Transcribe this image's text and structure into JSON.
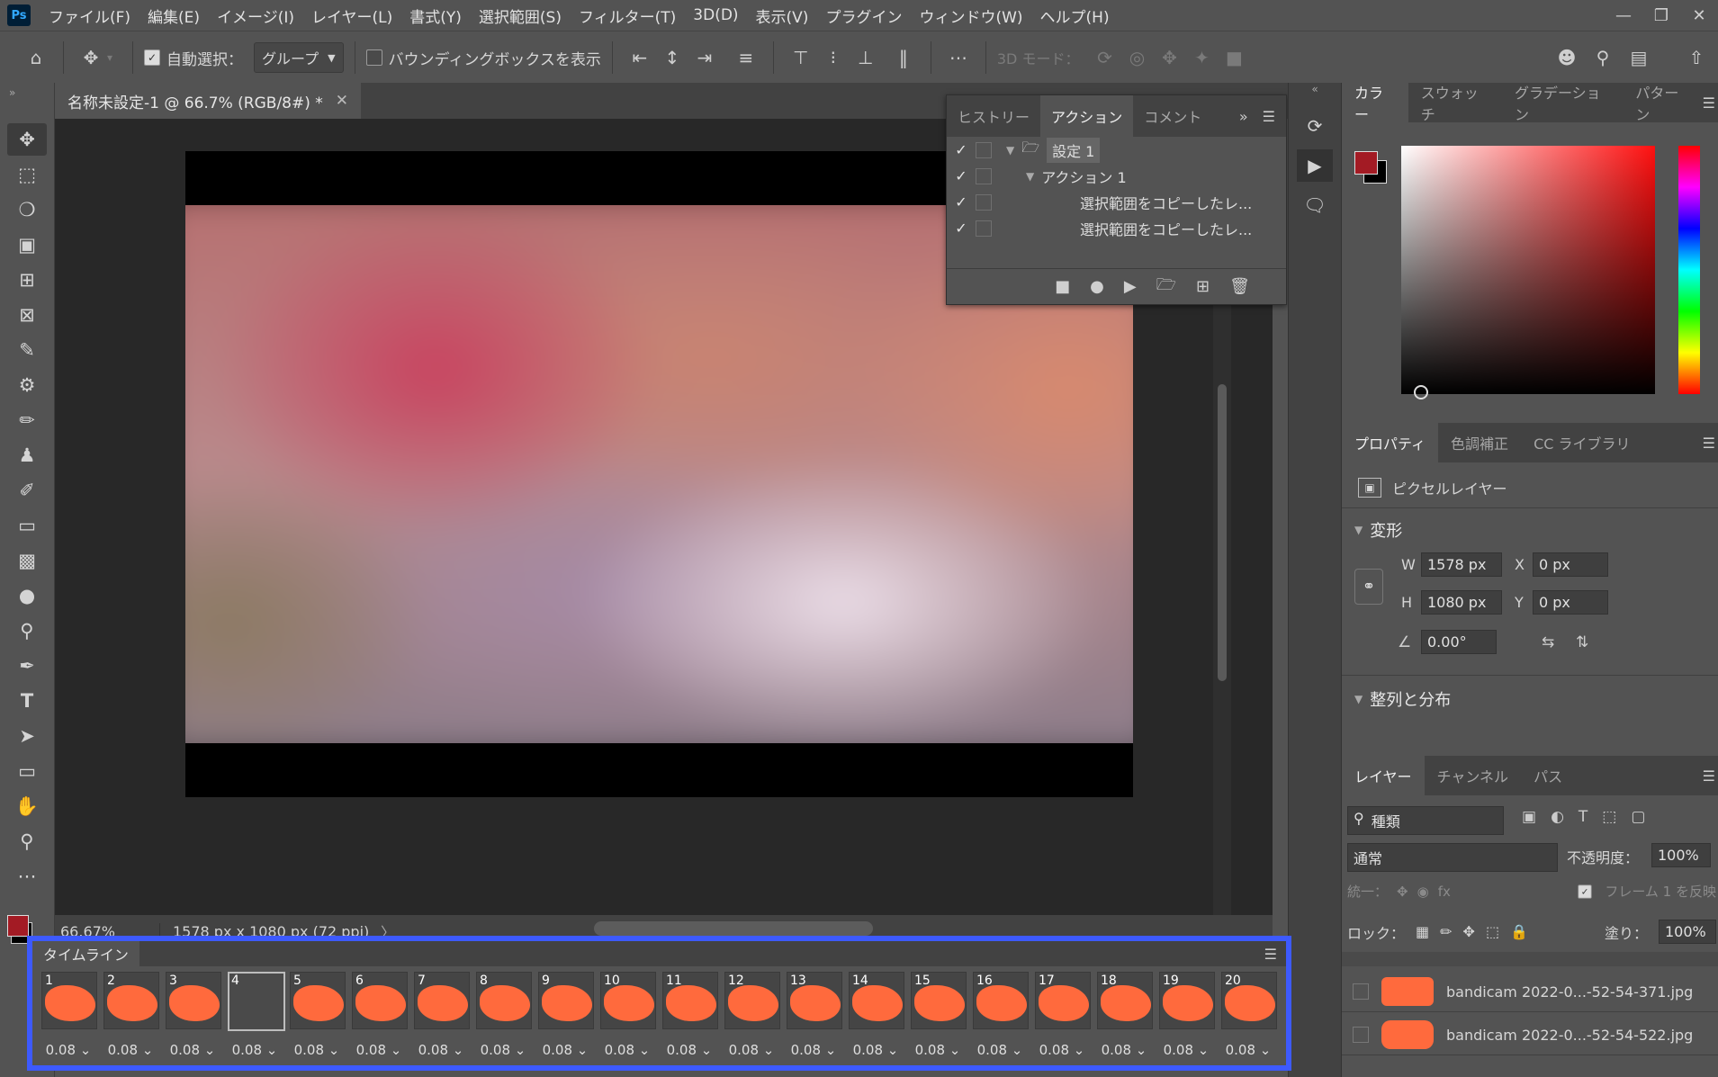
{
  "menu": [
    "ファイル(F)",
    "編集(E)",
    "イメージ(I)",
    "レイヤー(L)",
    "書式(Y)",
    "選択範囲(S)",
    "フィルター(T)",
    "3D(D)",
    "表示(V)",
    "プラグイン",
    "ウィンドウ(W)",
    "ヘルプ(H)"
  ],
  "logo": "Ps",
  "options": {
    "auto_select_label": "自動選択：",
    "auto_select_value": "グループ",
    "bbox_label": "バウンディングボックスを表示",
    "mode3d_label": "3D モード："
  },
  "document": {
    "tab_title": "名称未設定-1 @ 66.7% (RGB/8#) *",
    "zoom": "66.67%",
    "info": "1578 px x 1080 px (72 ppi)"
  },
  "actions_panel": {
    "tabs": [
      "ヒストリー",
      "アクション",
      "コメント"
    ],
    "rows": [
      {
        "checked": true,
        "label": "設定 1"
      },
      {
        "checked": true,
        "label": "アクション 1"
      },
      {
        "checked": true,
        "label": "選択範囲をコピーしたレ..."
      },
      {
        "checked": true,
        "label": "選択範囲をコピーしたレ..."
      }
    ]
  },
  "color_panel": {
    "tabs": [
      "カラー",
      "スウォッチ",
      "グラデーション",
      "パターン"
    ],
    "foreground": "#a31b24",
    "background": "#000000"
  },
  "properties_panel": {
    "tabs": [
      "プロパティ",
      "色調補正",
      "CC ライブラリ"
    ],
    "layer_type": "ピクセルレイヤー",
    "transform_title": "変形",
    "w": "1578 px",
    "h": "1080 px",
    "x": "0 px",
    "y": "0 px",
    "angle": "0.00°",
    "align_title": "整列と分布"
  },
  "layers_panel": {
    "tabs": [
      "レイヤー",
      "チャンネル",
      "パス"
    ],
    "filter": "種類",
    "blend_mode": "通常",
    "opacity_label": "不透明度：",
    "opacity": "100%",
    "unify_label": "統一：",
    "propagate_label": "フレーム 1 を反映",
    "lock_label": "ロック：",
    "fill_label": "塗り：",
    "fill": "100%",
    "layers": [
      "bandicam 2022-0...-52-54-371.jpg",
      "bandicam 2022-0...-52-54-522.jpg"
    ]
  },
  "timeline": {
    "title": "タイムライン",
    "selected_frame": 4,
    "frames": [
      {
        "n": "1",
        "delay": "0.08"
      },
      {
        "n": "2",
        "delay": "0.08"
      },
      {
        "n": "3",
        "delay": "0.08"
      },
      {
        "n": "4",
        "delay": "0.08"
      },
      {
        "n": "5",
        "delay": "0.08"
      },
      {
        "n": "6",
        "delay": "0.08"
      },
      {
        "n": "7",
        "delay": "0.08"
      },
      {
        "n": "8",
        "delay": "0.08"
      },
      {
        "n": "9",
        "delay": "0.08"
      },
      {
        "n": "10",
        "delay": "0.08"
      },
      {
        "n": "11",
        "delay": "0.08"
      },
      {
        "n": "12",
        "delay": "0.08"
      },
      {
        "n": "13",
        "delay": "0.08"
      },
      {
        "n": "14",
        "delay": "0.08"
      },
      {
        "n": "15",
        "delay": "0.08"
      },
      {
        "n": "16",
        "delay": "0.08"
      },
      {
        "n": "17",
        "delay": "0.08"
      },
      {
        "n": "18",
        "delay": "0.08"
      },
      {
        "n": "19",
        "delay": "0.08"
      },
      {
        "n": "20",
        "delay": "0.08"
      }
    ]
  }
}
